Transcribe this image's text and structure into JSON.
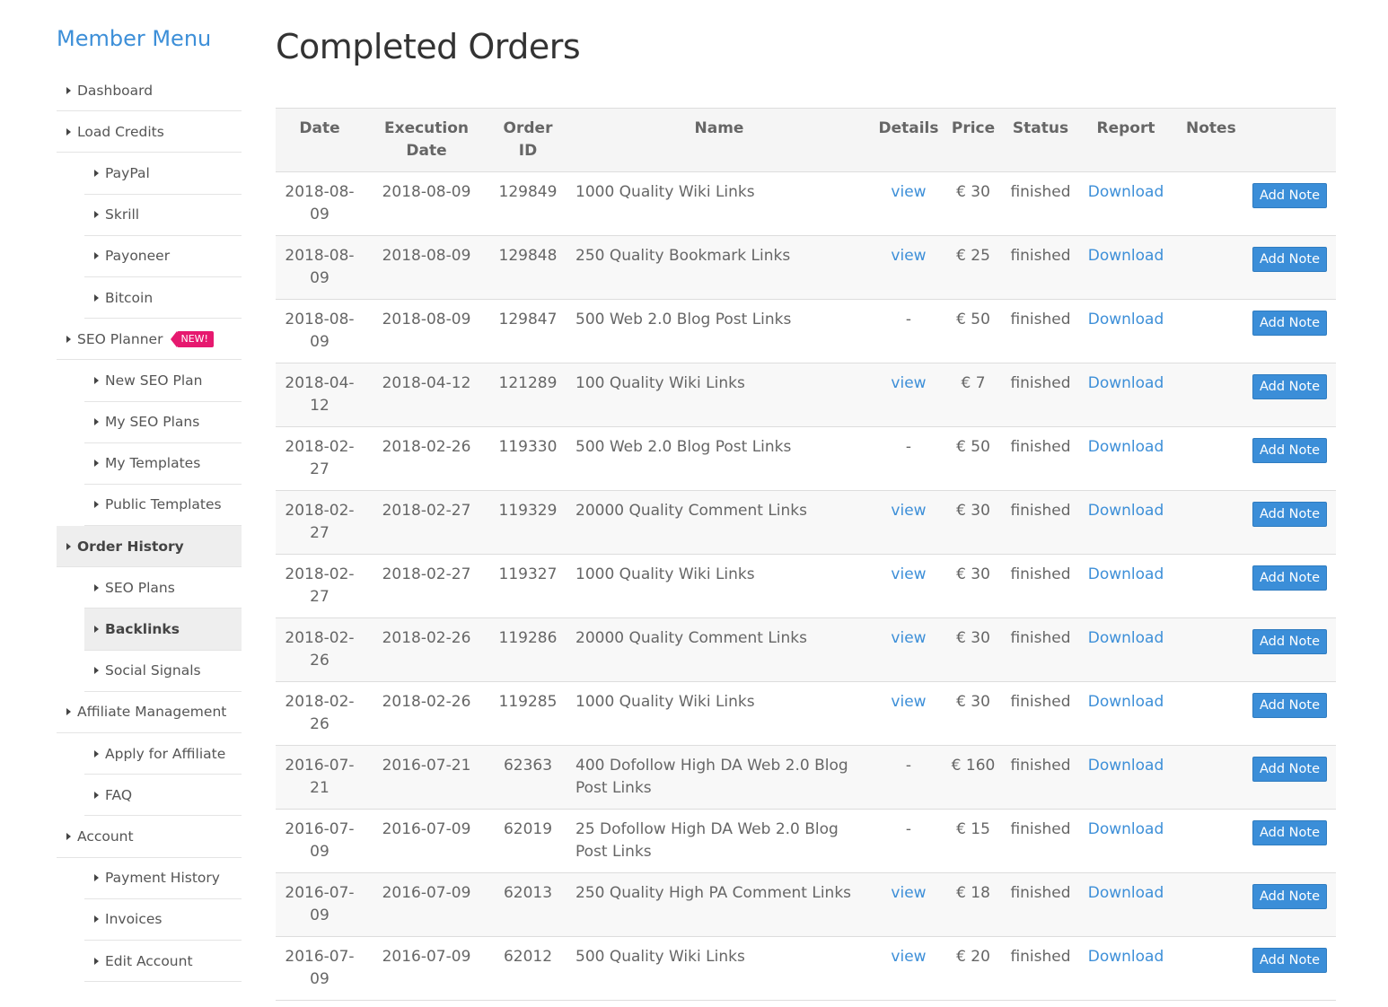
{
  "sidebar": {
    "title": "Member Menu",
    "items": [
      {
        "label": "Dashboard",
        "level": 0,
        "active": false
      },
      {
        "label": "Load Credits",
        "level": 0,
        "active": false
      },
      {
        "label": "PayPal",
        "level": 1,
        "active": false
      },
      {
        "label": "Skrill",
        "level": 1,
        "active": false
      },
      {
        "label": "Payoneer",
        "level": 1,
        "active": false
      },
      {
        "label": "Bitcoin",
        "level": 1,
        "active": false
      },
      {
        "label": "SEO Planner",
        "level": 0,
        "active": false,
        "badge": "NEW!"
      },
      {
        "label": "New SEO Plan",
        "level": 1,
        "active": false
      },
      {
        "label": "My SEO Plans",
        "level": 1,
        "active": false
      },
      {
        "label": "My Templates",
        "level": 1,
        "active": false
      },
      {
        "label": "Public Templates",
        "level": 1,
        "active": false
      },
      {
        "label": "Order History",
        "level": 0,
        "active": true
      },
      {
        "label": "SEO Plans",
        "level": 1,
        "active": false
      },
      {
        "label": "Backlinks",
        "level": 1,
        "active": true
      },
      {
        "label": "Social Signals",
        "level": 1,
        "active": false
      },
      {
        "label": "Affiliate Management",
        "level": 0,
        "active": false
      },
      {
        "label": "Apply for Affiliate",
        "level": 1,
        "active": false
      },
      {
        "label": "FAQ",
        "level": 1,
        "active": false
      },
      {
        "label": "Account",
        "level": 0,
        "active": false
      },
      {
        "label": "Payment History",
        "level": 1,
        "active": false
      },
      {
        "label": "Invoices",
        "level": 1,
        "active": false
      },
      {
        "label": "Edit Account",
        "level": 1,
        "active": false
      }
    ]
  },
  "main": {
    "title": "Completed Orders",
    "columns": [
      "Date",
      "Execution Date",
      "Order ID",
      "Name",
      "Details",
      "Price",
      "Status",
      "Report",
      "Notes"
    ],
    "add_note_label": "Add Note",
    "rows": [
      {
        "date": "2018-08-09",
        "exec_date": "2018-08-09",
        "order_id": "129849",
        "name": "1000 Quality Wiki Links",
        "details": "view",
        "price": "€ 30",
        "status": "finished",
        "report": "Download"
      },
      {
        "date": "2018-08-09",
        "exec_date": "2018-08-09",
        "order_id": "129848",
        "name": "250 Quality Bookmark Links",
        "details": "view",
        "price": "€ 25",
        "status": "finished",
        "report": "Download"
      },
      {
        "date": "2018-08-09",
        "exec_date": "2018-08-09",
        "order_id": "129847",
        "name": "500 Web 2.0 Blog Post Links",
        "details": "-",
        "price": "€ 50",
        "status": "finished",
        "report": "Download"
      },
      {
        "date": "2018-04-12",
        "exec_date": "2018-04-12",
        "order_id": "121289",
        "name": "100 Quality Wiki Links",
        "details": "view",
        "price": "€ 7",
        "status": "finished",
        "report": "Download"
      },
      {
        "date": "2018-02-27",
        "exec_date": "2018-02-26",
        "order_id": "119330",
        "name": "500 Web 2.0 Blog Post Links",
        "details": "-",
        "price": "€ 50",
        "status": "finished",
        "report": "Download"
      },
      {
        "date": "2018-02-27",
        "exec_date": "2018-02-27",
        "order_id": "119329",
        "name": "20000 Quality Comment Links",
        "details": "view",
        "price": "€ 30",
        "status": "finished",
        "report": "Download"
      },
      {
        "date": "2018-02-27",
        "exec_date": "2018-02-27",
        "order_id": "119327",
        "name": "1000 Quality Wiki Links",
        "details": "view",
        "price": "€ 30",
        "status": "finished",
        "report": "Download"
      },
      {
        "date": "2018-02-26",
        "exec_date": "2018-02-26",
        "order_id": "119286",
        "name": "20000 Quality Comment Links",
        "details": "view",
        "price": "€ 30",
        "status": "finished",
        "report": "Download"
      },
      {
        "date": "2018-02-26",
        "exec_date": "2018-02-26",
        "order_id": "119285",
        "name": "1000 Quality Wiki Links",
        "details": "view",
        "price": "€ 30",
        "status": "finished",
        "report": "Download"
      },
      {
        "date": "2016-07-21",
        "exec_date": "2016-07-21",
        "order_id": "62363",
        "name": "400 Dofollow High DA Web 2.0 Blog Post Links",
        "details": "-",
        "price": "€ 160",
        "status": "finished",
        "report": "Download"
      },
      {
        "date": "2016-07-09",
        "exec_date": "2016-07-09",
        "order_id": "62019",
        "name": "25 Dofollow High DA Web 2.0 Blog Post Links",
        "details": "-",
        "price": "€ 15",
        "status": "finished",
        "report": "Download"
      },
      {
        "date": "2016-07-09",
        "exec_date": "2016-07-09",
        "order_id": "62013",
        "name": "250 Quality High PA Comment Links",
        "details": "view",
        "price": "€ 18",
        "status": "finished",
        "report": "Download"
      },
      {
        "date": "2016-07-09",
        "exec_date": "2016-07-09",
        "order_id": "62012",
        "name": "500 Quality Wiki Links",
        "details": "view",
        "price": "€ 20",
        "status": "finished",
        "report": "Download"
      }
    ]
  },
  "colors": {
    "accent": "#3d8fd8",
    "badge": "#e6196f",
    "button": "#3b8ed8",
    "text": "#666666"
  }
}
